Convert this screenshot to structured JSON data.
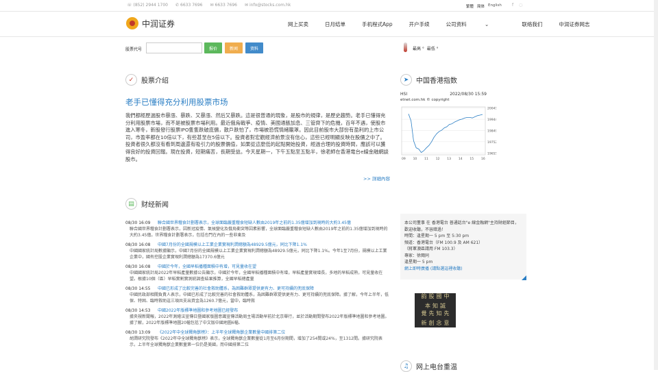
{
  "topbar": {
    "phone1": "(852) 2944 1700",
    "phone2": "6633 7696",
    "phone3": "6633 7696",
    "email": "info@stocks.com.hk",
    "lang_tc": "繁體",
    "lang_sc": "简体",
    "lang_en": "English"
  },
  "header": {
    "logo_text": "中润证券",
    "nav": [
      "网上买卖",
      "日月结单",
      "手机程式App",
      "开户手续",
      "公司资料",
      "联络我们",
      "中润证券网志"
    ]
  },
  "search": {
    "label": "股票代号",
    "btn_quote": "报价",
    "btn_news": "新闻",
    "btn_info": "资料",
    "temp_high": "最高 °",
    "temp_low": "最低 °"
  },
  "intro": {
    "section": "股票介绍",
    "headline": "老手已懂得充分利用股票市场",
    "body": "我們都經歷過股市暴漲、暴跌、又暴漲、然后又暴跌。這是很普通的現象，是股市的規律，是歷史趨勢。老手已懂得充分利用股票市場，而不是被股票市場利用。最近俄烏戰爭、疫情、美國通脹加息、三管齊下的危機，百年不遇，使股市進入寒冬，新股發行股票IPO隻隻跌破底價，散戶跌怕了，市場被恐慌情緒籠罩。因此目前股市大部份有盈利的上市公司，市盈率都在10倍以下，有些甚至在5倍以下。投資者對宏觀經濟前景沒有信心，這些已經明顯反映在股價之中了。投資者很久都沒有看到周邊還有吸引力的股票價值，如果從這麼低的起點開始投資，經過合理的投資時間，應該可以獲得良好的投資回報。現在投資，短期痛苦，長期受益。今天星期一，下午五點至五點半，徐老師在香港電台e線金融網談股市。",
    "more": ">> 詳細內容"
  },
  "hsi": {
    "section": "中国香港指数",
    "label": "HSI",
    "datetime": "2022/08/30 15:59",
    "source": "etnet.com.hk © copyright"
  },
  "chart_data": {
    "type": "line",
    "title": "",
    "categories": [
      "09",
      "10",
      "11",
      "12",
      "13",
      "14",
      "15",
      "16"
    ],
    "y_ticks": [
      19655,
      19752,
      19849,
      19944,
      20041
    ],
    "ylim": [
      19640,
      20050
    ],
    "values": [
      19990,
      19930,
      19760,
      19700,
      19690,
      19660,
      19675,
      19700,
      19720,
      19750,
      19790,
      19820,
      19840,
      19850,
      19870,
      19880,
      19900,
      19905,
      19920,
      19930,
      19940,
      19945,
      19955,
      19960,
      19960,
      19955,
      19965,
      19975,
      19980,
      19985
    ]
  },
  "finance": {
    "section": "财经新闻",
    "items": [
      {
        "time": "08/30 16:09",
        "title": "聯合國世界糧食計劃署表示，全球面臨嚴重糧食短缺人數由2019年之前的1.35億增加到現時的大約3.45億",
        "desc": "聯合國世界糧食計劃署表示，因新冠疫情、氣候變化及俄烏衝突等因素影響，全球面臨嚴重糧食短缺人數由2019年之前的1.35億增加到現時的大約3.45億。世界糧食計劃署表示，包括也門在內的一些非東及"
      },
      {
        "time": "08/30 16:08",
        "title": "中國7月份的全國規模以上工業企業實現利潤總額為48929.5億元，同比下降1.1%",
        "desc": "中國國家統計局數據顯示，中國7月份的全國規模以上工業企業實現利潤總額為48929.5億元，同比下降1.1%。今年1至7月份，規模以上工業企業中，國有控股企業實現利潤總額為17370.6億元"
      },
      {
        "time": "08/30 16:08",
        "title": "中國於今年，全國早稻播種面積中有增，可見量收在望",
        "desc": "中國國家統計局2022年早稻產量數據公告顯示，中國於今年，全國早稻播種面積中有增，早稻產量實現增長，多地的早稻成熟，可見量收在望。根據10個（區）早稻實割實測統調查結果推算，全國早稻總產量"
      },
      {
        "time": "08/30 14:55",
        "title": "中國已形成了比較完善的社會救助體系，為困難群眾提供更有力、更可持續的兜底保障",
        "desc": "中國民政部相關負責人表示，中國已形成了比較完善的社會救助體系，為困難群眾提供更有力、更可持續的兜底保障。據了解，今年上半年，低保、特困、臨時救助這三項共支出資金為1260.7億元，當中，臨時救"
      },
      {
        "time": "08/30 14:53",
        "title": "中國2022年版標準地圖和參考地圖已經發布",
        "desc": "據央視新聞報，2022年測繪法宣傳日暨國家版圖意識宣傳活動周主場活動早前於北京舉行，並於活動期間發布2022年版標準地圖和參考地圖。據了解，2022年版標準地圖20幅包括了中文版中國地圖6幅、"
      },
      {
        "time": "08/30 13:09",
        "title": "《2022年中全球獨角獸榜》：上半年全球獨角獸企業數量中國排第二位",
        "desc": "胡潤研究院發布《2022年中全球獨角獸榜》表示，全球獨角獸企業數量從1月至6月份期間，增加了254間或24%，至1312間。據研究院表示，上半年全球獨角獸企業數量第一位仍是美國，而中國排第二位"
      }
    ]
  },
  "radio": {
    "line1": "本公司董事 在 香港電台 普通話台\"e 線金融網\"主持財經節目，歡迎收聽，不容錯過！",
    "time": "時間：逢星期一 5 pm 至 5:30 pm",
    "channel": "頻道：香港電台（FM 100.9 及 AM 621）",
    "channel2": "（將軍澳區請用 FM 103.3）",
    "guest": "專家：徐閩同",
    "repeat": "逢星期一 5 pm",
    "link": "網上即時廣播 (請點選這裡收聽)",
    "book_cols": [
      "中國股韵",
      "誠知本",
      "先知先覺",
      "意念創新"
    ],
    "replay_title": "网上电台重温"
  },
  "colors": {
    "link_blue": "#2a7ec4",
    "btn_green": "#5cb85c",
    "btn_orange": "#f0ad4e",
    "btn_blue": "#428bca"
  }
}
